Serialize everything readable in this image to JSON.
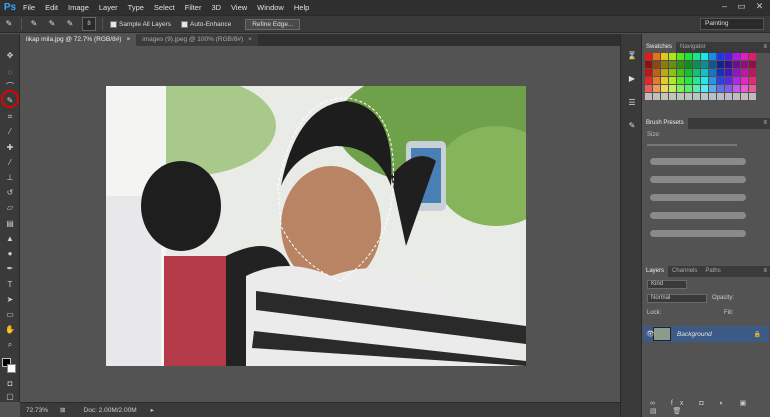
{
  "app": {
    "logo": "Ps"
  },
  "menu": [
    "File",
    "Edit",
    "Image",
    "Layer",
    "Type",
    "Select",
    "Filter",
    "3D",
    "View",
    "Window",
    "Help"
  ],
  "window_controls": [
    "–",
    "▭",
    "✕"
  ],
  "options_bar": {
    "brush_size": "8",
    "sample_all_layers": "Sample All Layers",
    "auto_enhance": "Auto-Enhance",
    "refine_edge": "Refine Edge...",
    "workspace": "Painting"
  },
  "tabs": [
    {
      "label": "likap mila.jpg @ 72.7% (RGB/8#)",
      "close": "×"
    },
    {
      "label": "images (9).jpeg @ 100% (RGB/8#)",
      "close": "×"
    }
  ],
  "status": {
    "zoom": "72.73%",
    "doc": "Doc: 2.00M/2.00M"
  },
  "panels": {
    "swatches_tabs": [
      "Swatches",
      "Navigator"
    ],
    "brush_presets_tab": "Brush Presets",
    "brush_size_label": "Size:",
    "layers_tabs": [
      "Layers",
      "Channels",
      "Paths"
    ],
    "kind": "Kind",
    "blend_mode": "Normal",
    "opacity_label": "Opacity:",
    "lock_label": "Lock:",
    "fill_label": "Fill:",
    "layer_name": "Background"
  },
  "colors": {
    "accent": "#31a8ff",
    "highlight_ring": "#e60000",
    "selected_layer": "#3d5a85"
  }
}
